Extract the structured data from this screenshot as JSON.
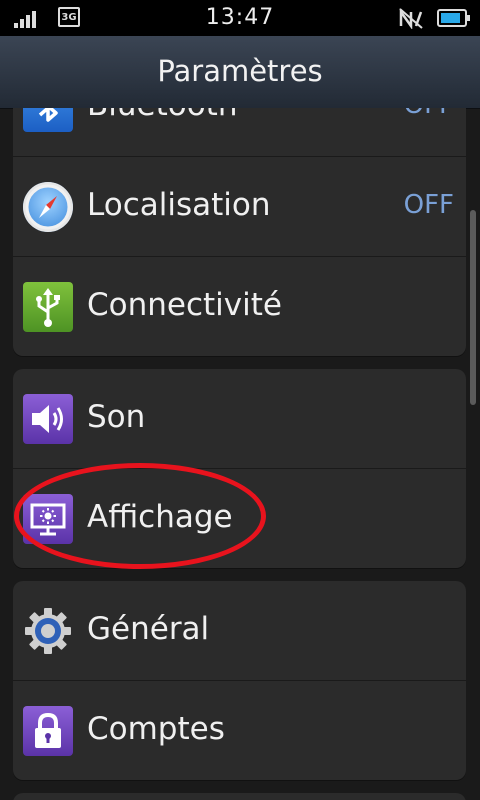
{
  "status_bar": {
    "time": "13:47",
    "network_label": "3G",
    "battery_level": 0.85,
    "icons": [
      "signal-icon",
      "network-3g-icon",
      "no-signal-icon",
      "battery-icon"
    ]
  },
  "header": {
    "title": "Paramètres"
  },
  "groups": [
    {
      "items": [
        {
          "label": "Bluetooth",
          "value": "OFF",
          "icon": "bluetooth-icon"
        },
        {
          "label": "Localisation",
          "value": "OFF",
          "icon": "compass-icon"
        },
        {
          "label": "Connectivité",
          "value": "",
          "icon": "usb-icon"
        }
      ]
    },
    {
      "items": [
        {
          "label": "Son",
          "value": "",
          "icon": "speaker-icon"
        },
        {
          "label": "Affichage",
          "value": "",
          "icon": "display-icon"
        }
      ]
    },
    {
      "items": [
        {
          "label": "Général",
          "value": "",
          "icon": "gear-icon"
        },
        {
          "label": "Comptes",
          "value": "",
          "icon": "lock-icon"
        }
      ]
    }
  ],
  "colors": {
    "accent_value": "#7aa0d6",
    "highlight_circle": "#e8131d",
    "title_bar": "#2c3542"
  }
}
